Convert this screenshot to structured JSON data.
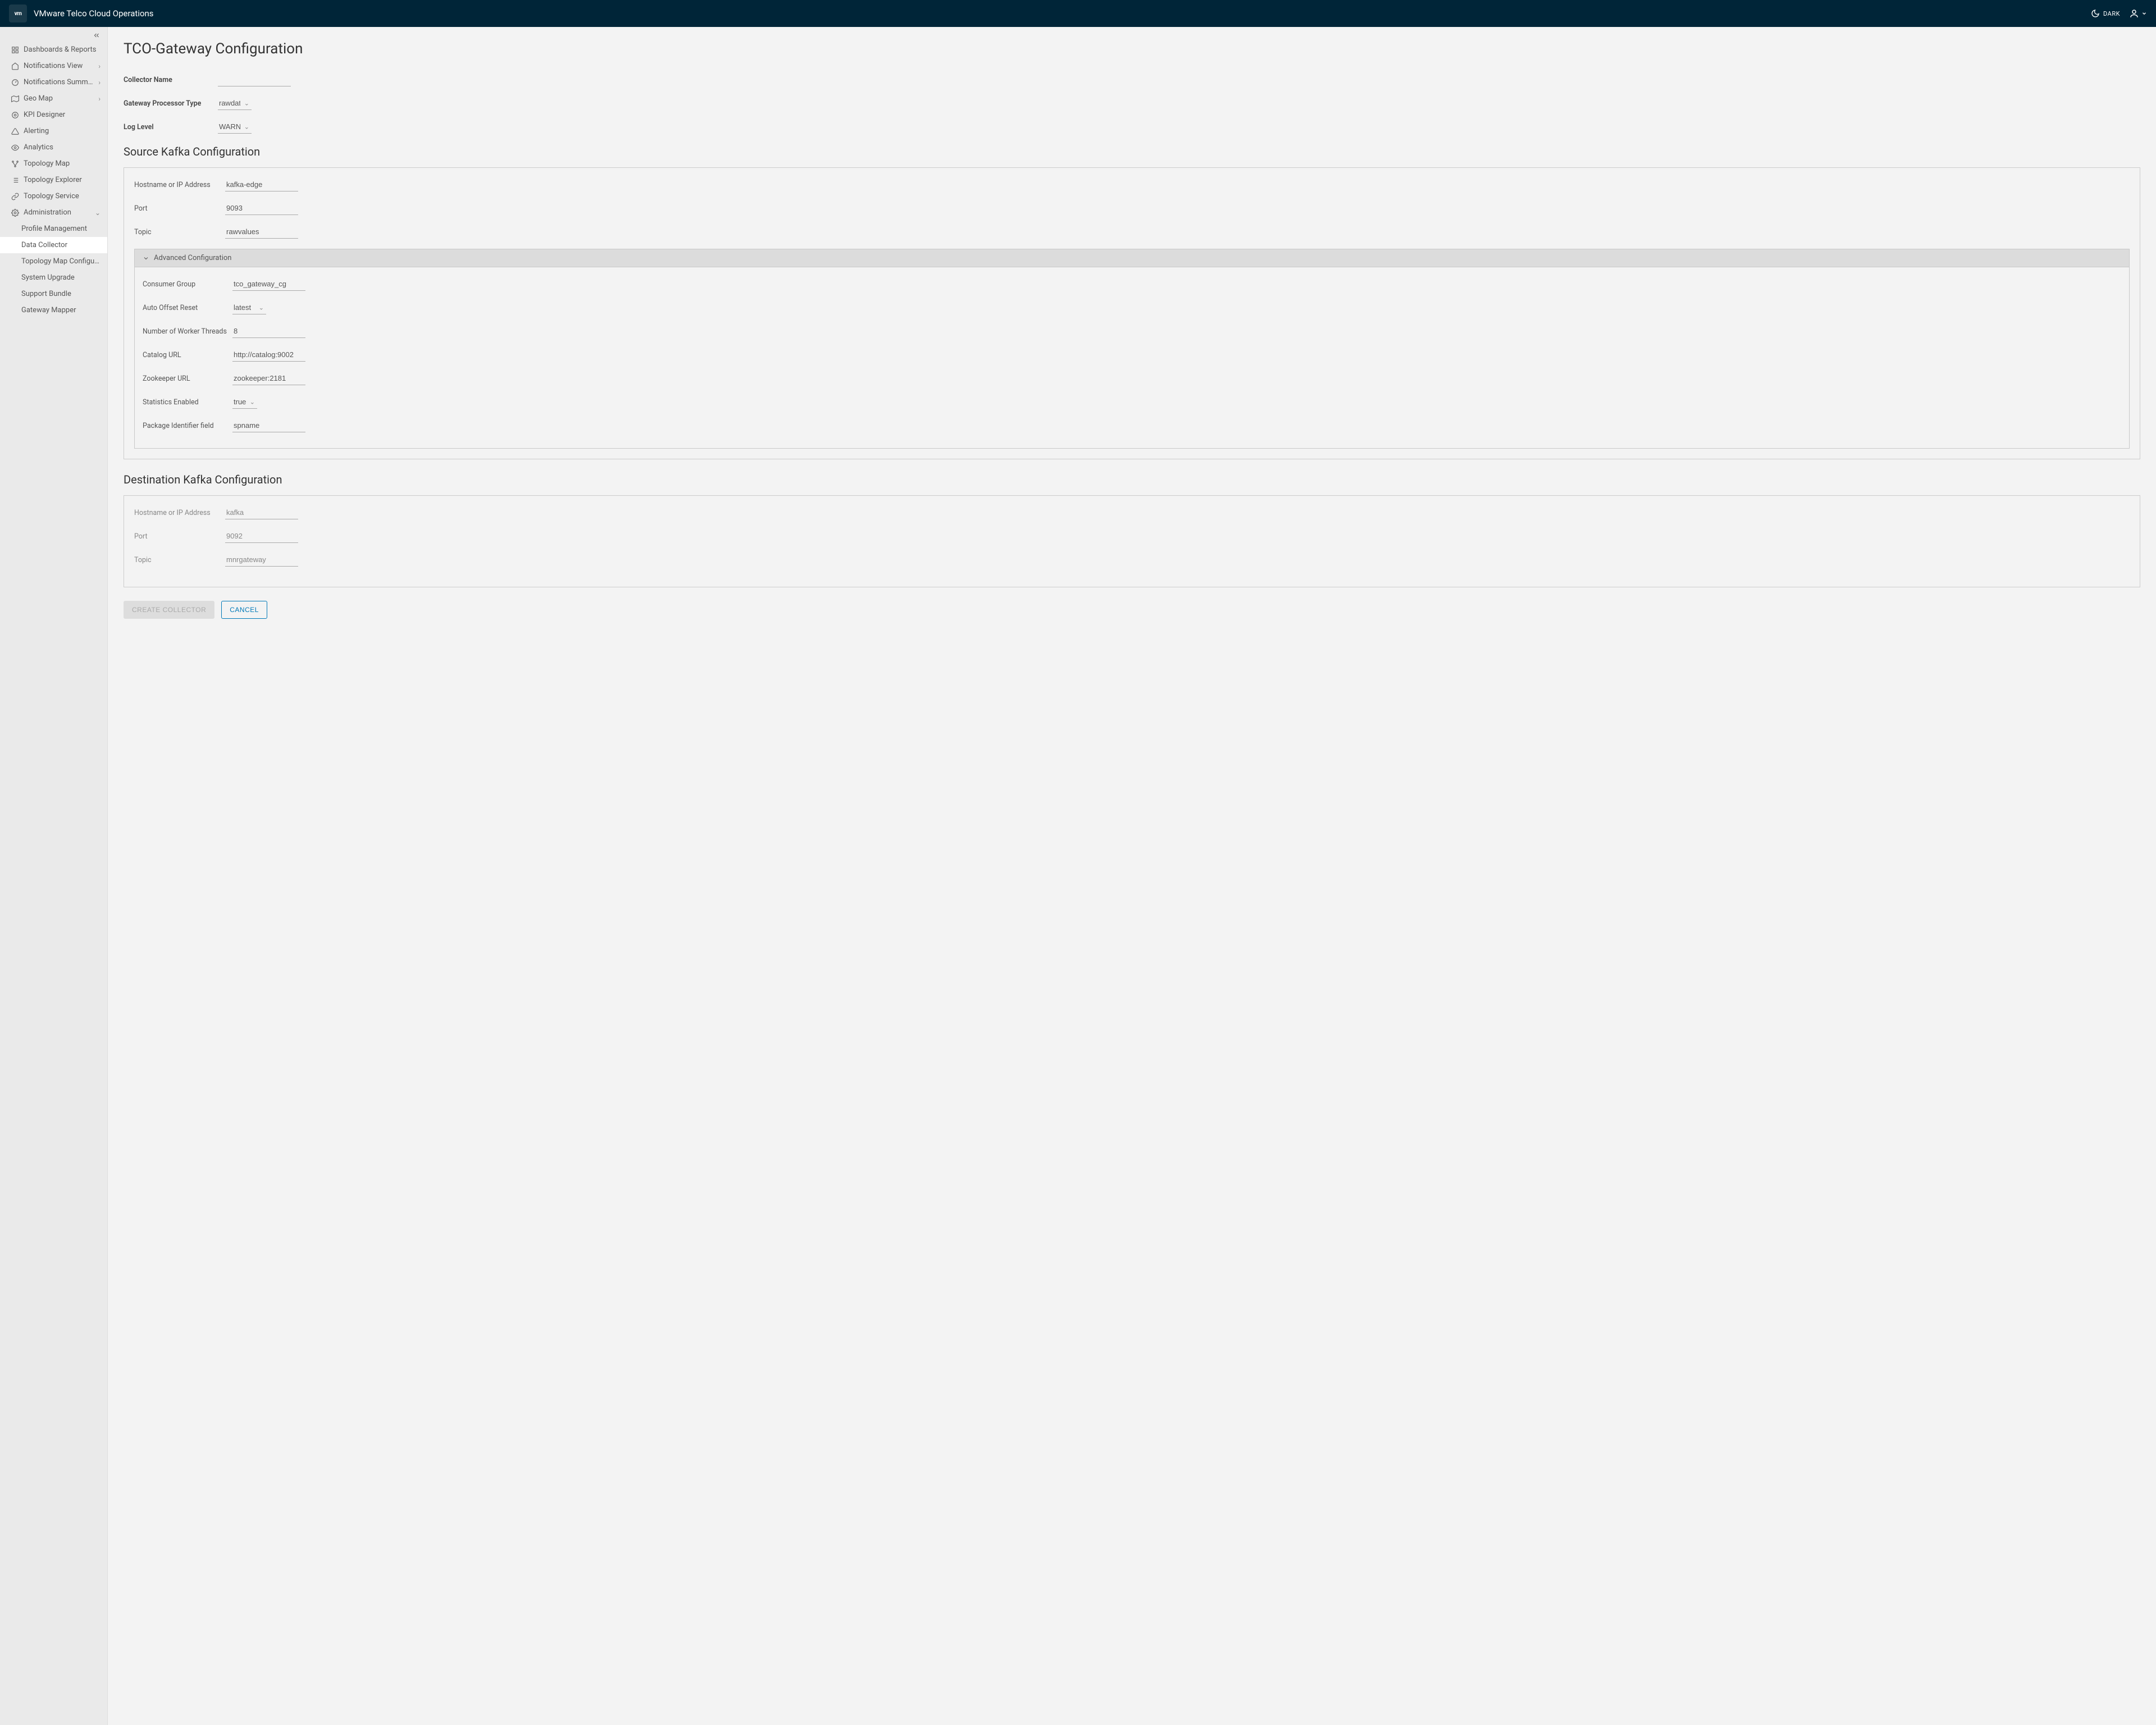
{
  "header": {
    "logo_text": "vm",
    "title": "VMware Telco Cloud Operations",
    "dark_label": "DARK"
  },
  "sidebar": {
    "items": [
      {
        "label": "Dashboards & Reports",
        "icon": "dashboard",
        "caret": ""
      },
      {
        "label": "Notifications View",
        "icon": "home",
        "caret": "›"
      },
      {
        "label": "Notifications Summ…",
        "icon": "gauge",
        "caret": "›"
      },
      {
        "label": "Geo Map",
        "icon": "map",
        "caret": "›"
      },
      {
        "label": "KPI Designer",
        "icon": "kpi",
        "caret": ""
      },
      {
        "label": "Alerting",
        "icon": "alert",
        "caret": ""
      },
      {
        "label": "Analytics",
        "icon": "eye",
        "caret": ""
      },
      {
        "label": "Topology Map",
        "icon": "topo",
        "caret": ""
      },
      {
        "label": "Topology Explorer",
        "icon": "explorer",
        "caret": ""
      },
      {
        "label": "Topology Service",
        "icon": "service",
        "caret": ""
      },
      {
        "label": "Administration",
        "icon": "gear",
        "caret": "⌄"
      }
    ],
    "admin_sub": [
      "Profile Management",
      "Data Collector",
      "Topology Map Configurat…",
      "System Upgrade",
      "Support Bundle",
      "Gateway Mapper"
    ],
    "active_sub_index": 1
  },
  "page": {
    "title": "TCO-Gateway Configuration",
    "collector_name_label": "Collector Name",
    "collector_name_value": "",
    "gateway_type_label": "Gateway Processor Type",
    "gateway_type_value": "rawdata",
    "log_level_label": "Log Level",
    "log_level_value": "WARN"
  },
  "source": {
    "title": "Source Kafka Configuration",
    "hostname_label": "Hostname or IP Address",
    "hostname_value": "kafka-edge",
    "port_label": "Port",
    "port_value": "9093",
    "topic_label": "Topic",
    "topic_value": "rawvalues",
    "adv_title": "Advanced Configuration",
    "consumer_group_label": "Consumer Group",
    "consumer_group_value": "tco_gateway_cg",
    "auto_offset_label": "Auto Offset Reset",
    "auto_offset_value": "latest",
    "workers_label": "Number of Worker Threads",
    "workers_value": "8",
    "catalog_label": "Catalog URL",
    "catalog_value": "http://catalog:9002",
    "zookeeper_label": "Zookeeper URL",
    "zookeeper_value": "zookeeper:2181",
    "stats_label": "Statistics Enabled",
    "stats_value": "true",
    "pkg_label": "Package Identifier field",
    "pkg_value": "spname"
  },
  "dest": {
    "title": "Destination Kafka Configuration",
    "hostname_label": "Hostname or IP Address",
    "hostname_value": "kafka",
    "port_label": "Port",
    "port_value": "9092",
    "topic_label": "Topic",
    "topic_value": "mnrgateway"
  },
  "actions": {
    "create": "CREATE COLLECTOR",
    "cancel": "CANCEL"
  }
}
